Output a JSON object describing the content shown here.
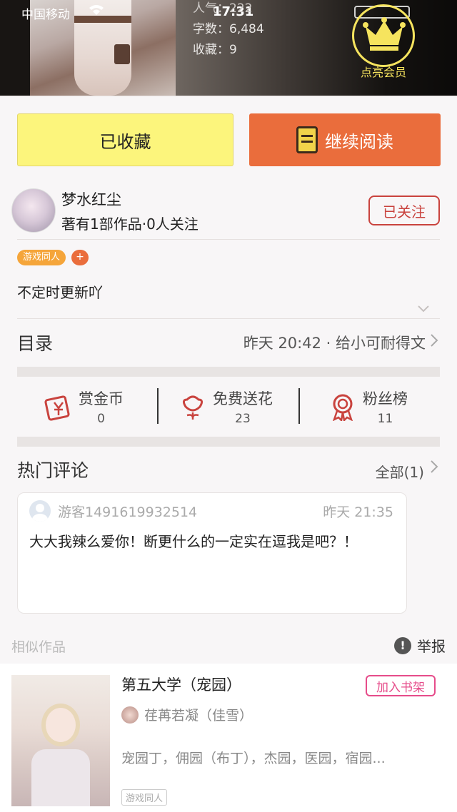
{
  "status_bar": {
    "carrier": "中国移动",
    "time": "17:31"
  },
  "book_stats": {
    "popularity": "人气：222",
    "word_count": "字数：6,484",
    "favorites": "收藏：9"
  },
  "vip": {
    "label": "点亮会员",
    "icon": "crown-icon"
  },
  "actions": {
    "collect_label": "已收藏",
    "read_label": "继续阅读"
  },
  "author": {
    "name": "梦水红尘",
    "meta": "著有1部作品·0人关注",
    "follow_label": "已关注"
  },
  "tags": {
    "items": [
      "游戏同人"
    ],
    "add_label": "+"
  },
  "description": "不定时更新吖",
  "catalog": {
    "title": "目录",
    "latest": "昨天 20:42 · 给小可耐得文"
  },
  "engagement": {
    "reward": {
      "label": "赏金币",
      "count": "0"
    },
    "flowers": {
      "label": "免费送花",
      "count": "23"
    },
    "fans": {
      "label": "粉丝榜",
      "count": "11"
    }
  },
  "comments": {
    "title": "热门评论",
    "all_label": "全部(1)",
    "items": [
      {
        "user": "游客1491619932514",
        "time": "昨天 21:35",
        "text": "大大我辣么爱你！断更什么的一定实在逗我是吧？！"
      }
    ]
  },
  "similar": {
    "section_label": "相似作品",
    "report_label": "举报",
    "items": [
      {
        "title": "第五大学（宠园）",
        "shelf_label": "加入书架",
        "author": "荏苒若凝（佳雪）",
        "desc": "宠园丁，佣园（布丁），杰园，医园，宿园...",
        "tag": "游戏同人"
      }
    ]
  },
  "colors": {
    "accent_orange": "#ea6d3c",
    "collect_yellow": "#fcf57c",
    "follow_red": "#c9433e",
    "vip_gold": "#f6e45e",
    "shelf_pink": "#e64c8a"
  }
}
